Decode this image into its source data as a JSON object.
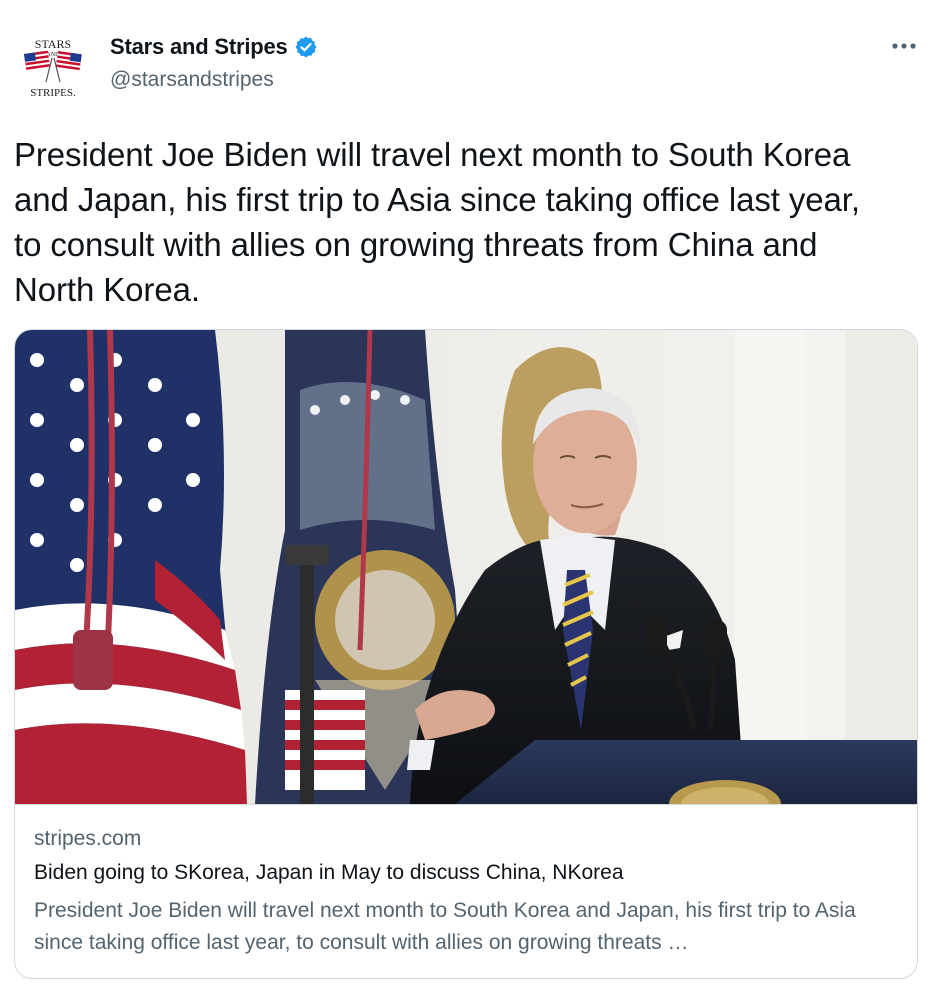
{
  "author": {
    "display_name": "Stars and Stripes",
    "handle": "@starsandstripes",
    "verified": true,
    "avatar_icon": "stars-and-stripes-logo-icon",
    "avatar_text": [
      "STARS",
      "AND",
      "STRIPES."
    ]
  },
  "more_icon": "more-options-icon",
  "tweet": {
    "text": "President Joe Biden will travel next month to South Korea and Japan, his first trip to Asia since taking office last year, to consult with allies on growing threats from China and North Korea."
  },
  "link_card": {
    "domain": "stripes.com",
    "title": "Biden going to SKorea, Japan in May to discuss China, NKorea",
    "description": "President Joe Biden will travel next month to South Korea and Japan, his first trip to Asia since taking office last year, to consult with allies on growing threats …",
    "image_icon": "article-photo"
  },
  "colors": {
    "text_primary": "#0f1419",
    "text_secondary": "#536471",
    "verified_blue": "#1d9bf0",
    "border": "#cfd9de"
  }
}
